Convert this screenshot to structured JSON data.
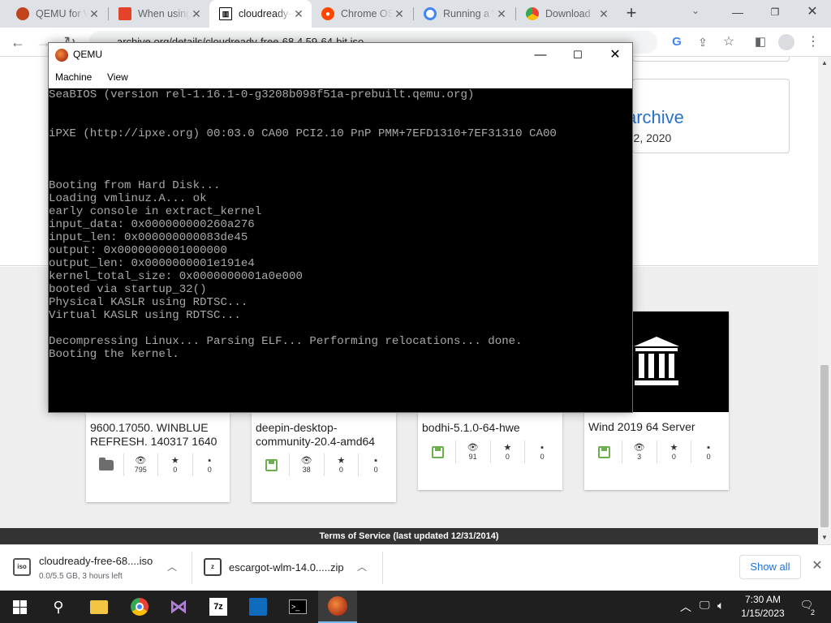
{
  "browser": {
    "tabs": [
      {
        "title": "QEMU for Windows",
        "icon": "qemu-icon",
        "color": "#c0431d"
      },
      {
        "title": "When using GitLab",
        "icon": "gitlab-icon",
        "color": "#e24329"
      },
      {
        "title": "cloudready-free",
        "icon": "archive-org-icon",
        "color": "#000000",
        "active": true
      },
      {
        "title": "Chrome OS Flex",
        "icon": "reddit-icon",
        "color": "#ff4500"
      },
      {
        "title": "Running a VM",
        "icon": "google-icon",
        "color": "#4285f4"
      },
      {
        "title": "Download",
        "icon": "chrome-icon",
        "color": "#34a853"
      }
    ],
    "url": "archive.org/details/cloudready-free-68.4.59-64-bit.iso"
  },
  "page": {
    "archive_title": "archive",
    "archive_date": "r 2, 2020",
    "cards": [
      {
        "title": "9600.17050. WINBLUE REFRESH. 140317 1640",
        "media": "folder-icon",
        "views": "795",
        "favorites": "0",
        "comments": "0"
      },
      {
        "title": "deepin-desktop-community-20.4-amd64",
        "media": "floppy-icon",
        "views": "38",
        "favorites": "0",
        "comments": "0"
      },
      {
        "title": "bodhi-5.1.0-64-hwe",
        "media": "floppy-icon",
        "views": "91",
        "favorites": "0",
        "comments": "0"
      },
      {
        "title": "Wind 2019 64 Server",
        "media": "floppy-icon",
        "views": "3",
        "favorites": "0",
        "comments": "0"
      }
    ],
    "tos": "Terms of Service (last updated 12/31/2014)"
  },
  "qemu": {
    "title": "QEMU",
    "menu": [
      "Machine",
      "View"
    ],
    "console_lines": [
      "SeaBIOS (version rel-1.16.1-0-g3208b098f51a-prebuilt.qemu.org)",
      "",
      "",
      "iPXE (http://ipxe.org) 00:03.0 CA00 PCI2.10 PnP PMM+7EFD1310+7EF31310 CA00",
      "",
      "",
      "",
      "Booting from Hard Disk...",
      "Loading vmlinuz.A... ok",
      "early console in extract_kernel",
      "input_data: 0x000000000260a276",
      "input_len: 0x000000000083de45",
      "output: 0x0000000001000000",
      "output_len: 0x0000000001e191e4",
      "kernel_total_size: 0x0000000001a0e000",
      "booted via startup_32()",
      "Physical KASLR using RDTSC...",
      "Virtual KASLR using RDTSC...",
      "",
      "Decompressing Linux... Parsing ELF... Performing relocations... done.",
      "Booting the kernel."
    ]
  },
  "downloads": {
    "items": [
      {
        "name": "cloudready-free-68....iso",
        "status": "0.0/5.5 GB, 3 hours left",
        "icon": "iso-file-icon"
      },
      {
        "name": "escargot-wlm-14.0.....zip",
        "status": "",
        "icon": "zip-file-icon"
      }
    ],
    "show_all": "Show all"
  },
  "taskbar": {
    "time": "7:30 AM",
    "date": "1/15/2023",
    "notifications": "2",
    "apps": [
      "file-explorer-icon",
      "chrome-icon",
      "visual-studio-icon",
      "7zip-icon",
      "outlook-icon",
      "terminal-icon",
      "qemu-icon"
    ]
  }
}
